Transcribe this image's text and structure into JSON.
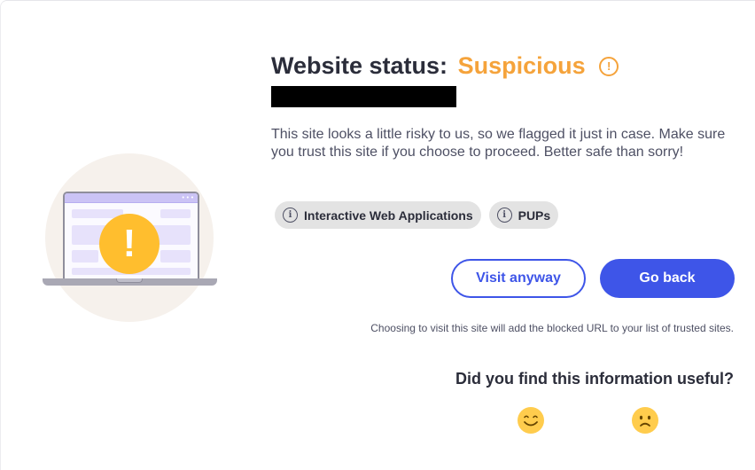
{
  "status": {
    "title_prefix": "Website status:",
    "status_word": "Suspicious",
    "status_icon": "exclamation-circle-icon",
    "status_color": "#f5a33b"
  },
  "description": "This site looks a little risky to us, so we flagged it just in case. Make sure you trust this site if you choose to proceed. Better safe than sorry!",
  "tags": [
    {
      "label": "Interactive Web Applications",
      "icon": "info-icon"
    },
    {
      "label": "PUPs",
      "icon": "info-icon"
    }
  ],
  "buttons": {
    "visit_anyway": "Visit anyway",
    "go_back": "Go back",
    "accent_color": "#3e55e8"
  },
  "note": "Choosing to visit this site will add the blocked URL to your list of trusted sites.",
  "feedback": {
    "question": "Did you find this information useful?",
    "options": [
      {
        "icon": "smiling-face-icon"
      },
      {
        "icon": "frowning-face-icon"
      }
    ]
  }
}
